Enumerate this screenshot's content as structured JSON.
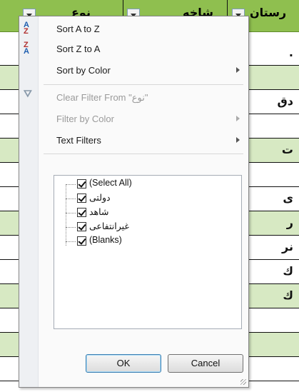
{
  "header": {
    "col_type": "نوع",
    "col_branch": "شاخه",
    "col_city": "رستان"
  },
  "rows": [
    {
      "cell": "."
    },
    {
      "cell": "دق"
    },
    {
      "cell": ""
    },
    {
      "cell": "ت"
    },
    {
      "cell": ""
    },
    {
      "cell": "ى"
    },
    {
      "cell": "ر"
    },
    {
      "cell": "نر"
    },
    {
      "cell": "ك"
    },
    {
      "cell": "ك"
    },
    {
      "cell": ""
    },
    {
      "cell": ""
    },
    {
      "cell": ""
    },
    {
      "cell": ""
    }
  ],
  "menu": {
    "sort_az": "Sort A to Z",
    "sort_za": "Sort Z to A",
    "sort_color": "Sort by Color",
    "clear_filter": "Clear Filter From \"نوع\"",
    "filter_color": "Filter by Color",
    "text_filters": "Text Filters"
  },
  "filter_list": {
    "select_all": "(Select All)",
    "opt1": "دولتی",
    "opt2": "شاهد",
    "opt3": "غیرانتفاعی",
    "blanks": "(Blanks)"
  },
  "buttons": {
    "ok": "OK",
    "cancel": "Cancel"
  }
}
